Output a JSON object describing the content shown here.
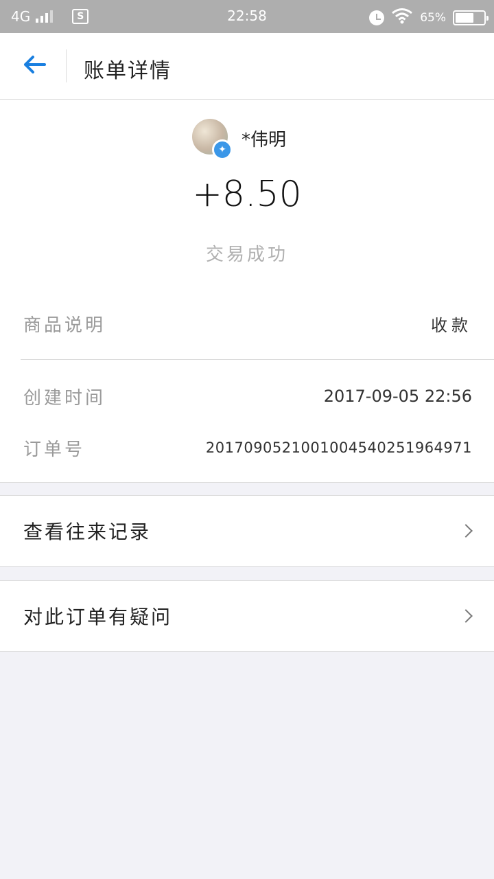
{
  "status_bar": {
    "network": "4G",
    "time": "22:58",
    "battery_percent": "65%",
    "battery_level": 0.65,
    "sim_label": "S",
    "icons": [
      "signal-icon",
      "sim-icon",
      "alarm-icon",
      "wifi-icon",
      "battery-icon"
    ]
  },
  "nav": {
    "title": "账单详情",
    "back_icon": "arrow-left-icon",
    "accent_color": "#1a7fe0"
  },
  "summary": {
    "payer_name": "*伟明",
    "amount": "+8.50",
    "status": "交易成功",
    "badge_icon": "sparkle-icon",
    "badge_color": "#3b97e8"
  },
  "details": [
    {
      "label": "商品说明",
      "value": "收款"
    },
    {
      "label": "创建时间",
      "value": "2017-09-05 22:56"
    },
    {
      "label": "订单号",
      "value": "2017090521001004540251964971"
    }
  ],
  "actions": [
    {
      "label": "查看往来记录",
      "icon": "chevron-right-icon"
    },
    {
      "label": "对此订单有疑问",
      "icon": "chevron-right-icon"
    }
  ]
}
